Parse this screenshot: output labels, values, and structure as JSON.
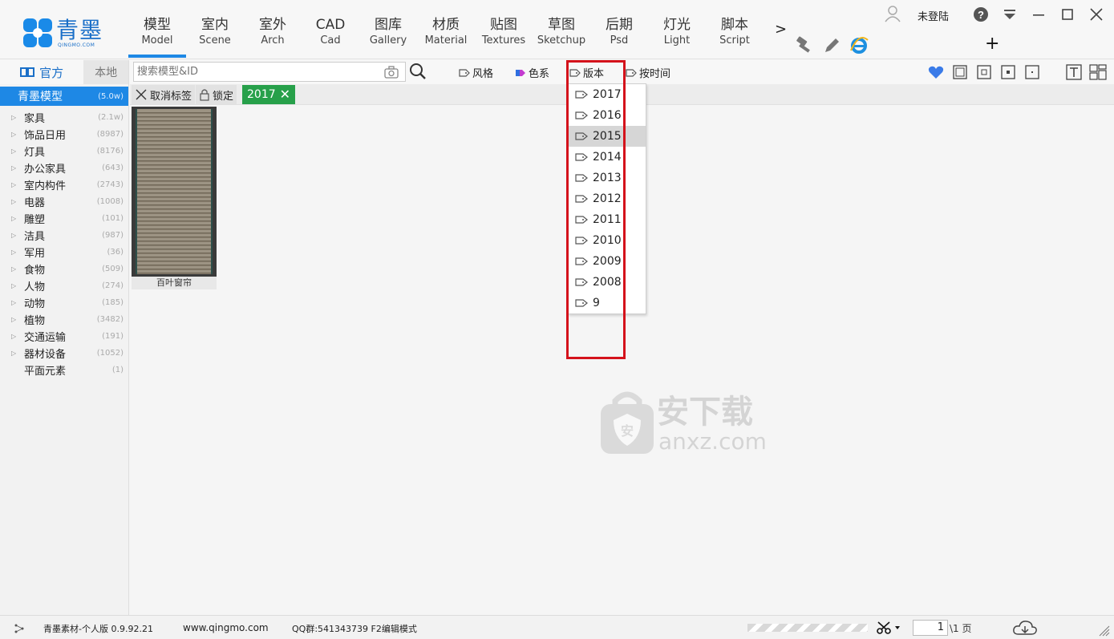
{
  "app": {
    "logo_text": "青墨",
    "logo_sub": "QINGMO.COM"
  },
  "nav": [
    {
      "zh": "模型",
      "en": "Model",
      "active": true
    },
    {
      "zh": "室内",
      "en": "Scene"
    },
    {
      "zh": "室外",
      "en": "Arch"
    },
    {
      "zh": "CAD",
      "en": "Cad"
    },
    {
      "zh": "图库",
      "en": "Gallery"
    },
    {
      "zh": "材质",
      "en": "Material"
    },
    {
      "zh": "贴图",
      "en": "Textures"
    },
    {
      "zh": "草图",
      "en": "Sketchup"
    },
    {
      "zh": "后期",
      "en": "Psd"
    },
    {
      "zh": "灯光",
      "en": "Light"
    },
    {
      "zh": "脚本",
      "en": "Script"
    }
  ],
  "nav_more": ">",
  "user": {
    "label": "未登陆"
  },
  "sidebar": {
    "tab_official": "官方",
    "tab_local": "本地",
    "root": {
      "label": "青墨模型",
      "count": "(5.0w)"
    },
    "categories": [
      {
        "name": "家具",
        "count": "(2.1w)",
        "expandable": true
      },
      {
        "name": "饰品日用",
        "count": "(8987)",
        "expandable": true
      },
      {
        "name": "灯具",
        "count": "(8176)",
        "expandable": true
      },
      {
        "name": "办公家具",
        "count": "(643)",
        "expandable": true
      },
      {
        "name": "室内构件",
        "count": "(2743)",
        "expandable": true
      },
      {
        "name": "电器",
        "count": "(1008)",
        "expandable": true
      },
      {
        "name": "雕塑",
        "count": "(101)",
        "expandable": true
      },
      {
        "name": "洁具",
        "count": "(987)",
        "expandable": true
      },
      {
        "name": "军用",
        "count": "(36)",
        "expandable": true
      },
      {
        "name": "食物",
        "count": "(509)",
        "expandable": true
      },
      {
        "name": "人物",
        "count": "(274)",
        "expandable": true
      },
      {
        "name": "动物",
        "count": "(185)",
        "expandable": true
      },
      {
        "name": "植物",
        "count": "(3482)",
        "expandable": true
      },
      {
        "name": "交通运输",
        "count": "(191)",
        "expandable": true
      },
      {
        "name": "器材设备",
        "count": "(1052)",
        "expandable": true
      },
      {
        "name": "平面元素",
        "count": "(1)",
        "expandable": false
      }
    ]
  },
  "toolbar": {
    "search_placeholder": "搜索模型&ID",
    "filters": {
      "style": "风格",
      "color": "色系",
      "version": "版本",
      "time": "按时间"
    }
  },
  "tagbar": {
    "cancel_label": "取消标签",
    "lock_label": "锁定",
    "active_tag": "2017"
  },
  "results": [
    {
      "label": "百叶窗帘"
    }
  ],
  "version_dropdown": {
    "items": [
      "2017",
      "2016",
      "2015",
      "2014",
      "2013",
      "2012",
      "2011",
      "2010",
      "2009",
      "2008",
      "9"
    ],
    "highlighted": "2015"
  },
  "watermark": {
    "text": "安下载",
    "sub": "anxz.com"
  },
  "status": {
    "version": "青墨素材-个人版 0.9.92.21",
    "website": "www.qingmo.com",
    "qq": "QQ群:541343739 F2编辑模式",
    "page_current": "1",
    "page_total": "\\1 页"
  },
  "colors": {
    "accent": "#1e88e5",
    "tag_chip": "#27a04a",
    "highlight_box": "#d4121b"
  }
}
